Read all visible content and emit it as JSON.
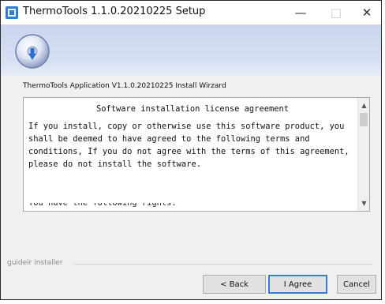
{
  "window": {
    "title": "ThermoTools 1.1.0.20210225 Setup",
    "controls": {
      "minimize": "—",
      "maximize": "□",
      "close": "✕"
    }
  },
  "wizard": {
    "label": "ThermoTools Application V1.1.0.20210225 Install Wirzard"
  },
  "license": {
    "heading": "Software installation license agreement",
    "body": "If you install, copy or otherwise use this software product, you shall be deemed to have agreed to the following terms and conditions, If you do not agree with the terms of this agreement, please do not install the software.",
    "cut_off_line": "You have the following rights:"
  },
  "footer": {
    "installer_label": "guideir installer"
  },
  "buttons": {
    "back": "< Back",
    "agree": "I Agree",
    "cancel": "Cancel"
  },
  "colors": {
    "accent": "#3c78d8",
    "banner": "#c9d4ef"
  },
  "icons": {
    "app": "app-icon",
    "installer_logo": "installer-disc-icon"
  }
}
